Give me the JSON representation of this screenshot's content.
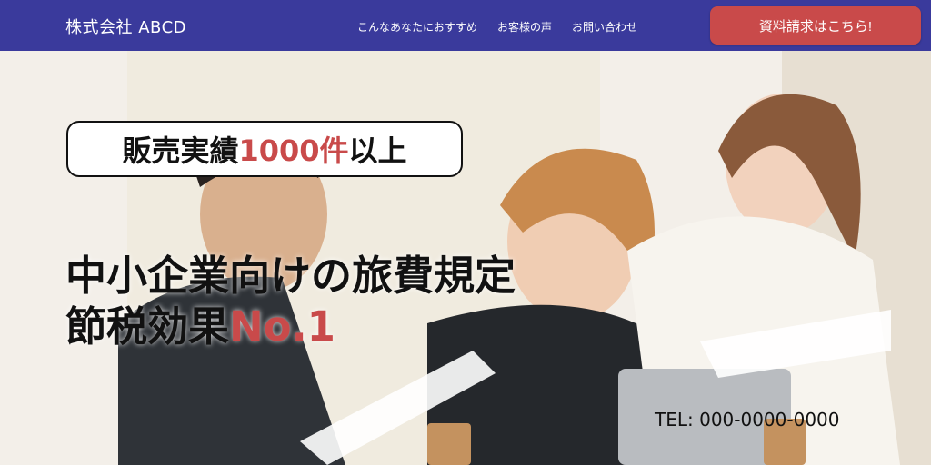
{
  "header": {
    "brand": "株式会社 ABCD",
    "nav": [
      "こんなあなたにおすすめ",
      "お客様の声",
      "お問い合わせ"
    ],
    "cta_label": "資料請求はこちら!"
  },
  "hero": {
    "badge": {
      "prefix": "販売実績",
      "highlight": "1000件",
      "suffix": "以上"
    },
    "headline_line1": "中小企業向けの旅費規定",
    "headline_line2_prefix": "節税効果",
    "headline_line2_highlight": "No.1",
    "tel": "TEL: 000-0000-0000"
  },
  "colors": {
    "header_bg": "#3a3a9c",
    "cta_bg": "#c94a4a",
    "accent_text": "#c94a4a"
  }
}
